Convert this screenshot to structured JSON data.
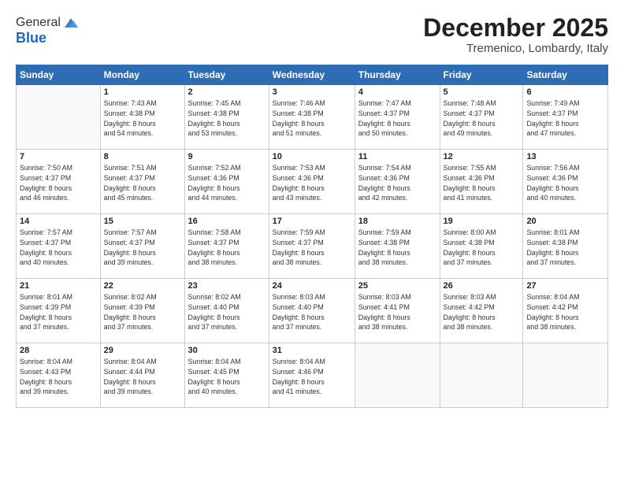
{
  "logo": {
    "general": "General",
    "blue": "Blue"
  },
  "title": "December 2025",
  "location": "Tremenico, Lombardy, Italy",
  "days_header": [
    "Sunday",
    "Monday",
    "Tuesday",
    "Wednesday",
    "Thursday",
    "Friday",
    "Saturday"
  ],
  "weeks": [
    [
      {
        "num": "",
        "info": ""
      },
      {
        "num": "1",
        "info": "Sunrise: 7:43 AM\nSunset: 4:38 PM\nDaylight: 8 hours\nand 54 minutes."
      },
      {
        "num": "2",
        "info": "Sunrise: 7:45 AM\nSunset: 4:38 PM\nDaylight: 8 hours\nand 53 minutes."
      },
      {
        "num": "3",
        "info": "Sunrise: 7:46 AM\nSunset: 4:38 PM\nDaylight: 8 hours\nand 51 minutes."
      },
      {
        "num": "4",
        "info": "Sunrise: 7:47 AM\nSunset: 4:37 PM\nDaylight: 8 hours\nand 50 minutes."
      },
      {
        "num": "5",
        "info": "Sunrise: 7:48 AM\nSunset: 4:37 PM\nDaylight: 8 hours\nand 49 minutes."
      },
      {
        "num": "6",
        "info": "Sunrise: 7:49 AM\nSunset: 4:37 PM\nDaylight: 8 hours\nand 47 minutes."
      }
    ],
    [
      {
        "num": "7",
        "info": "Sunrise: 7:50 AM\nSunset: 4:37 PM\nDaylight: 8 hours\nand 46 minutes."
      },
      {
        "num": "8",
        "info": "Sunrise: 7:51 AM\nSunset: 4:37 PM\nDaylight: 8 hours\nand 45 minutes."
      },
      {
        "num": "9",
        "info": "Sunrise: 7:52 AM\nSunset: 4:36 PM\nDaylight: 8 hours\nand 44 minutes."
      },
      {
        "num": "10",
        "info": "Sunrise: 7:53 AM\nSunset: 4:36 PM\nDaylight: 8 hours\nand 43 minutes."
      },
      {
        "num": "11",
        "info": "Sunrise: 7:54 AM\nSunset: 4:36 PM\nDaylight: 8 hours\nand 42 minutes."
      },
      {
        "num": "12",
        "info": "Sunrise: 7:55 AM\nSunset: 4:36 PM\nDaylight: 8 hours\nand 41 minutes."
      },
      {
        "num": "13",
        "info": "Sunrise: 7:56 AM\nSunset: 4:36 PM\nDaylight: 8 hours\nand 40 minutes."
      }
    ],
    [
      {
        "num": "14",
        "info": "Sunrise: 7:57 AM\nSunset: 4:37 PM\nDaylight: 8 hours\nand 40 minutes."
      },
      {
        "num": "15",
        "info": "Sunrise: 7:57 AM\nSunset: 4:37 PM\nDaylight: 8 hours\nand 39 minutes."
      },
      {
        "num": "16",
        "info": "Sunrise: 7:58 AM\nSunset: 4:37 PM\nDaylight: 8 hours\nand 38 minutes."
      },
      {
        "num": "17",
        "info": "Sunrise: 7:59 AM\nSunset: 4:37 PM\nDaylight: 8 hours\nand 38 minutes."
      },
      {
        "num": "18",
        "info": "Sunrise: 7:59 AM\nSunset: 4:38 PM\nDaylight: 8 hours\nand 38 minutes."
      },
      {
        "num": "19",
        "info": "Sunrise: 8:00 AM\nSunset: 4:38 PM\nDaylight: 8 hours\nand 37 minutes."
      },
      {
        "num": "20",
        "info": "Sunrise: 8:01 AM\nSunset: 4:38 PM\nDaylight: 8 hours\nand 37 minutes."
      }
    ],
    [
      {
        "num": "21",
        "info": "Sunrise: 8:01 AM\nSunset: 4:39 PM\nDaylight: 8 hours\nand 37 minutes."
      },
      {
        "num": "22",
        "info": "Sunrise: 8:02 AM\nSunset: 4:39 PM\nDaylight: 8 hours\nand 37 minutes."
      },
      {
        "num": "23",
        "info": "Sunrise: 8:02 AM\nSunset: 4:40 PM\nDaylight: 8 hours\nand 37 minutes."
      },
      {
        "num": "24",
        "info": "Sunrise: 8:03 AM\nSunset: 4:40 PM\nDaylight: 8 hours\nand 37 minutes."
      },
      {
        "num": "25",
        "info": "Sunrise: 8:03 AM\nSunset: 4:41 PM\nDaylight: 8 hours\nand 38 minutes."
      },
      {
        "num": "26",
        "info": "Sunrise: 8:03 AM\nSunset: 4:42 PM\nDaylight: 8 hours\nand 38 minutes."
      },
      {
        "num": "27",
        "info": "Sunrise: 8:04 AM\nSunset: 4:42 PM\nDaylight: 8 hours\nand 38 minutes."
      }
    ],
    [
      {
        "num": "28",
        "info": "Sunrise: 8:04 AM\nSunset: 4:43 PM\nDaylight: 8 hours\nand 39 minutes."
      },
      {
        "num": "29",
        "info": "Sunrise: 8:04 AM\nSunset: 4:44 PM\nDaylight: 8 hours\nand 39 minutes."
      },
      {
        "num": "30",
        "info": "Sunrise: 8:04 AM\nSunset: 4:45 PM\nDaylight: 8 hours\nand 40 minutes."
      },
      {
        "num": "31",
        "info": "Sunrise: 8:04 AM\nSunset: 4:46 PM\nDaylight: 8 hours\nand 41 minutes."
      },
      {
        "num": "",
        "info": ""
      },
      {
        "num": "",
        "info": ""
      },
      {
        "num": "",
        "info": ""
      }
    ]
  ]
}
